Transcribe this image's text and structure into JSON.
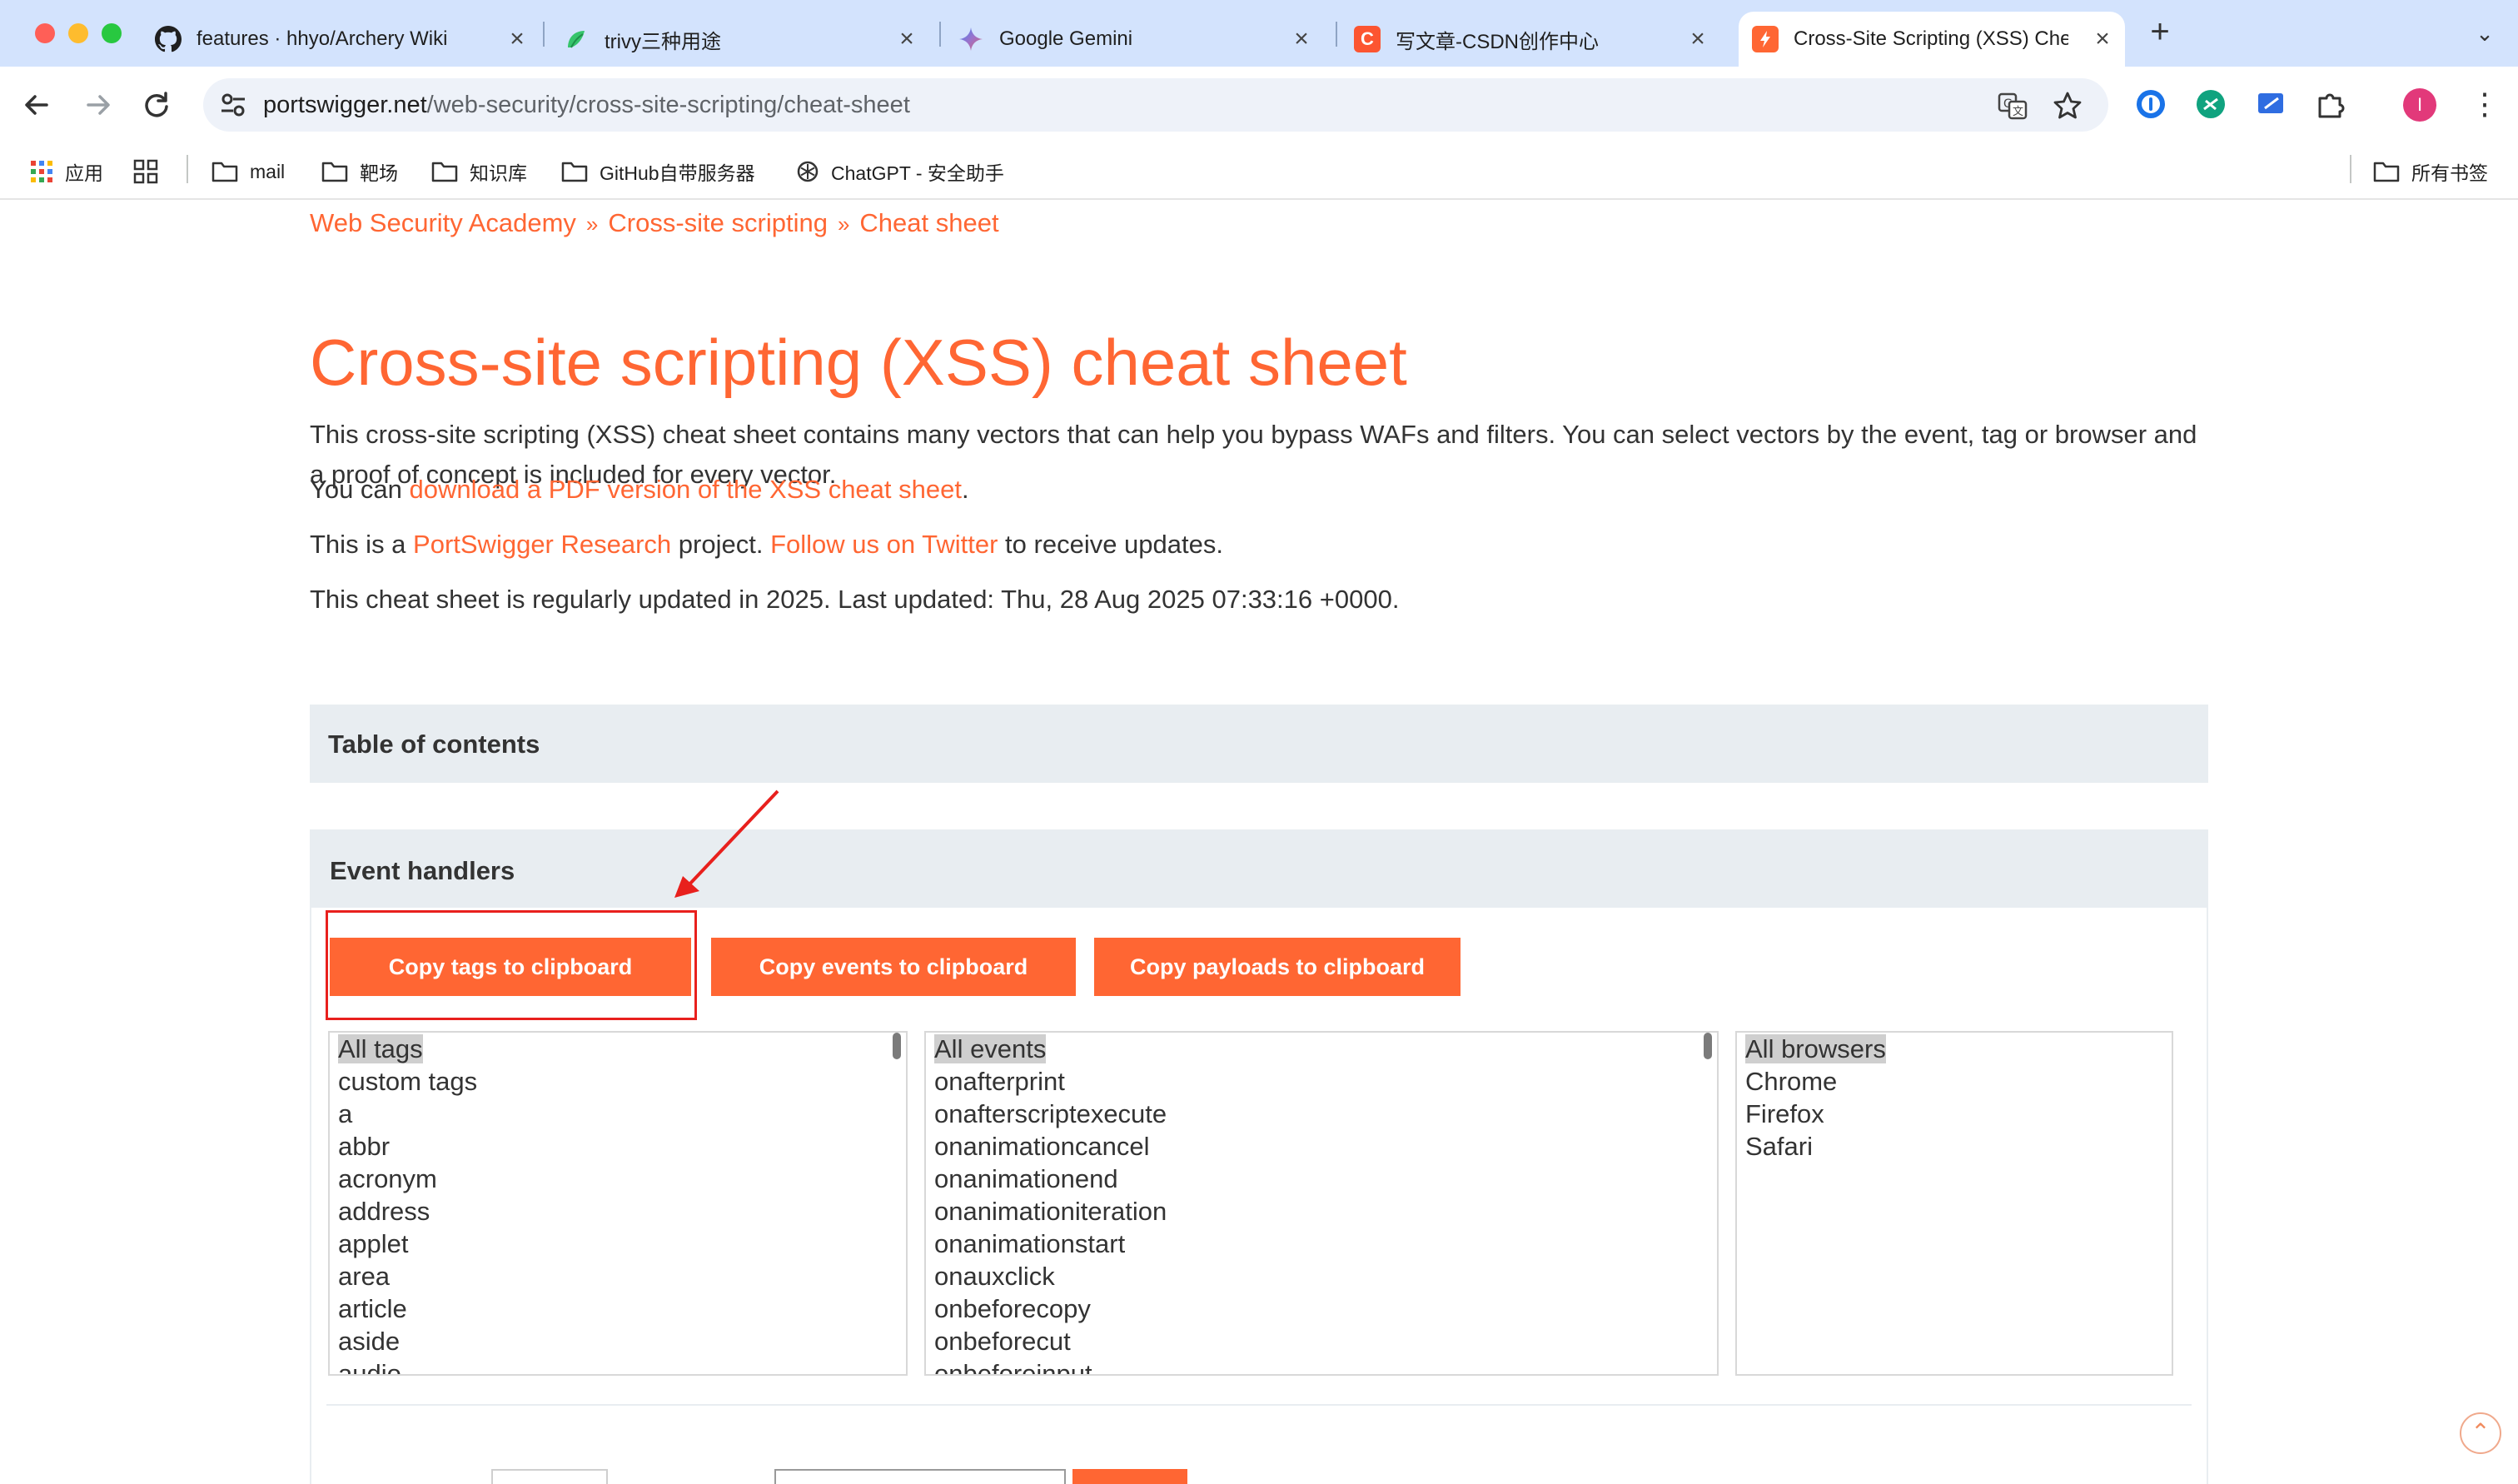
{
  "browser": {
    "tabs": [
      {
        "label": "features · hhyo/Archery Wiki",
        "icon": "github-icon",
        "close": "×"
      },
      {
        "label": "trivy三种用途",
        "icon": "yuque-icon",
        "close": "×"
      },
      {
        "label": "Google Gemini",
        "icon": "gemini-icon",
        "close": "×"
      },
      {
        "label": "写文章-CSDN创作中心",
        "icon": "csdn-icon",
        "close": "×"
      },
      {
        "label": "Cross-Site Scripting (XSS) Cheat",
        "icon": "portswigger-icon",
        "close": "×",
        "active": true
      }
    ],
    "new_tab": "+",
    "tab_menu": "⌄",
    "url_host": "portswigger.net",
    "url_path": "/web-security/cross-site-scripting/cheat-sheet",
    "avatar_letter": "I",
    "bookmarks": [
      {
        "label": "应用",
        "icon": "apps-grid-icon"
      },
      {
        "label": "mail",
        "icon": "folder-icon"
      },
      {
        "label": "靶场",
        "icon": "folder-icon"
      },
      {
        "label": "知识库",
        "icon": "folder-icon"
      },
      {
        "label": "GitHub自带服务器",
        "icon": "folder-icon"
      },
      {
        "label": "ChatGPT - 安全助手",
        "icon": "openai-icon"
      }
    ],
    "all_bookmarks": "所有书签"
  },
  "page": {
    "breadcrumb": [
      "Web Security Academy",
      "Cross-site scripting",
      "Cheat sheet"
    ],
    "breadcrumb_sep": "»",
    "title": "Cross-site scripting (XSS) cheat sheet",
    "intro": "This cross-site scripting (XSS) cheat sheet contains many vectors that can help you bypass WAFs and filters. You can select vectors by the event, tag or browser and a proof of concept is included for every vector.",
    "pdf_prefix": "You can ",
    "pdf_link": "download a PDF version of the XSS cheat sheet",
    "pdf_suffix": ".",
    "project_prefix": "This is a ",
    "project_link": "PortSwigger Research",
    "project_mid": " project. ",
    "twitter_link": "Follow us on Twitter",
    "project_suffix": " to receive updates.",
    "updated": "This cheat sheet is regularly updated in 2025. Last updated: Thu, 28 Aug 2025 07:33:16 +0000.",
    "toc_title": "Table of contents",
    "events_title": "Event handlers",
    "buttons": {
      "copy_tags": "Copy tags to clipboard",
      "copy_events": "Copy events to clipboard",
      "copy_payloads": "Copy payloads to clipboard"
    },
    "tags_list": [
      "All tags",
      "custom tags",
      "a",
      "abbr",
      "acronym",
      "address",
      "applet",
      "area",
      "article",
      "aside",
      "audio"
    ],
    "events_list": [
      "All events",
      "onafterprint",
      "onafterscriptexecute",
      "onanimationcancel",
      "onanimationend",
      "onanimationiteration",
      "onanimationstart",
      "onauxclick",
      "onbeforecopy",
      "onbeforecut",
      "onbeforeinput"
    ],
    "browsers_list": [
      "All browsers",
      "Chrome",
      "Firefox",
      "Safari"
    ]
  },
  "colors": {
    "brand_orange": "#ff6633",
    "annotation_red": "#e8201d",
    "panel_gray": "#e8edf1"
  }
}
